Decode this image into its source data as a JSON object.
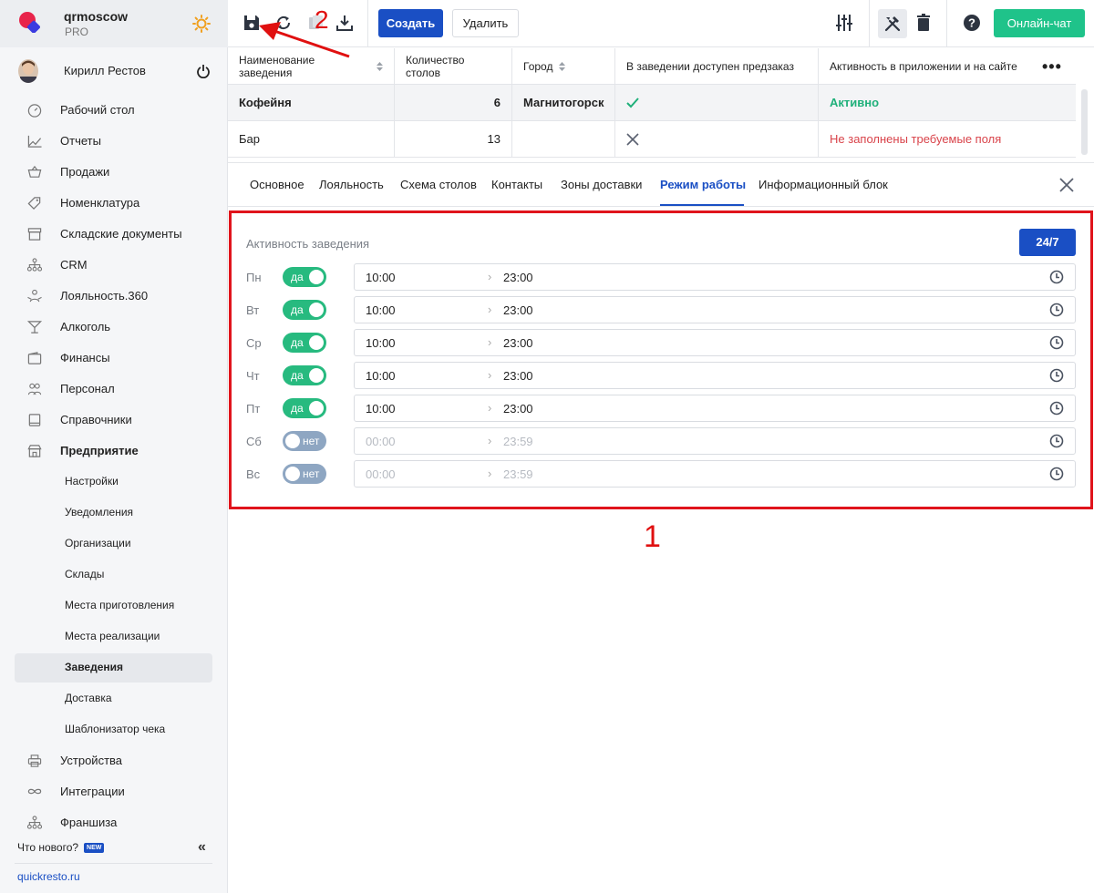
{
  "brand": {
    "name": "qrmoscow",
    "plan": "PRO"
  },
  "user": {
    "name": "Кирилл Рестов"
  },
  "nav": [
    {
      "label": "Рабочий стол",
      "icon": "gauge-icon"
    },
    {
      "label": "Отчеты",
      "icon": "chart-icon"
    },
    {
      "label": "Продажи",
      "icon": "basket-icon"
    },
    {
      "label": "Номенклатура",
      "icon": "tag-icon"
    },
    {
      "label": "Складские документы",
      "icon": "archive-icon"
    },
    {
      "label": "CRM",
      "icon": "hierarchy-icon"
    },
    {
      "label": "Лояльность.360",
      "icon": "loyalty-icon"
    },
    {
      "label": "Алкоголь",
      "icon": "cocktail-icon"
    },
    {
      "label": "Финансы",
      "icon": "wallet-icon"
    },
    {
      "label": "Персонал",
      "icon": "people-icon"
    },
    {
      "label": "Справочники",
      "icon": "book-icon"
    },
    {
      "label": "Предприятие",
      "icon": "store-icon"
    }
  ],
  "subnav": [
    "Настройки",
    "Уведомления",
    "Организации",
    "Склады",
    "Места приготовления",
    "Места реализации",
    "Заведения",
    "Доставка",
    "Шаблонизатор чека"
  ],
  "nav_bottom": [
    {
      "label": "Устройства",
      "icon": "printer-icon"
    },
    {
      "label": "Интеграции",
      "icon": "infinity-icon"
    },
    {
      "label": "Франшиза",
      "icon": "hierarchy-icon"
    }
  ],
  "whats_new": "Что нового?",
  "new_badge": "NEW",
  "site": "quickresto.ru",
  "toolbar": {
    "create": "Создать",
    "delete": "Удалить",
    "chat": "Онлайн-чат"
  },
  "annotations": {
    "a1": "1",
    "a2": "2"
  },
  "table": {
    "headers": [
      "Наименование заведения",
      "Количество столов",
      "Город",
      "В заведении доступен предзаказ",
      "Активность в приложении и на сайте"
    ],
    "rows": [
      {
        "name": "Кофейня",
        "tables": "6",
        "city": "Магнитогорск",
        "preorder": "check",
        "status": "Активно"
      },
      {
        "name": "Бар",
        "tables": "13",
        "city": "",
        "preorder": "cross",
        "status": "Не заполнены требуемые поля"
      }
    ]
  },
  "tabs": [
    "Основное",
    "Лояльность",
    "Схема столов",
    "Контакты",
    "Зоны доставки",
    "Режим работы",
    "Информационный блок"
  ],
  "active_tab": "Режим работы",
  "schedule": {
    "title": "Активность заведения",
    "always_button": "24/7",
    "days": [
      {
        "day": "Пн",
        "on": true,
        "toggle": "да",
        "from": "10:00",
        "to": "23:00"
      },
      {
        "day": "Вт",
        "on": true,
        "toggle": "да",
        "from": "10:00",
        "to": "23:00"
      },
      {
        "day": "Ср",
        "on": true,
        "toggle": "да",
        "from": "10:00",
        "to": "23:00"
      },
      {
        "day": "Чт",
        "on": true,
        "toggle": "да",
        "from": "10:00",
        "to": "23:00"
      },
      {
        "day": "Пт",
        "on": true,
        "toggle": "да",
        "from": "10:00",
        "to": "23:00"
      },
      {
        "day": "Сб",
        "on": false,
        "toggle": "нет",
        "from": "00:00",
        "to": "23:59"
      },
      {
        "day": "Вс",
        "on": false,
        "toggle": "нет",
        "from": "00:00",
        "to": "23:59"
      }
    ]
  },
  "colors": {
    "primary": "#1a4fc4",
    "success": "#27ba7f",
    "danger": "#d9434a",
    "annotation": "#e01010",
    "toggle_off": "#8ea6c2"
  }
}
